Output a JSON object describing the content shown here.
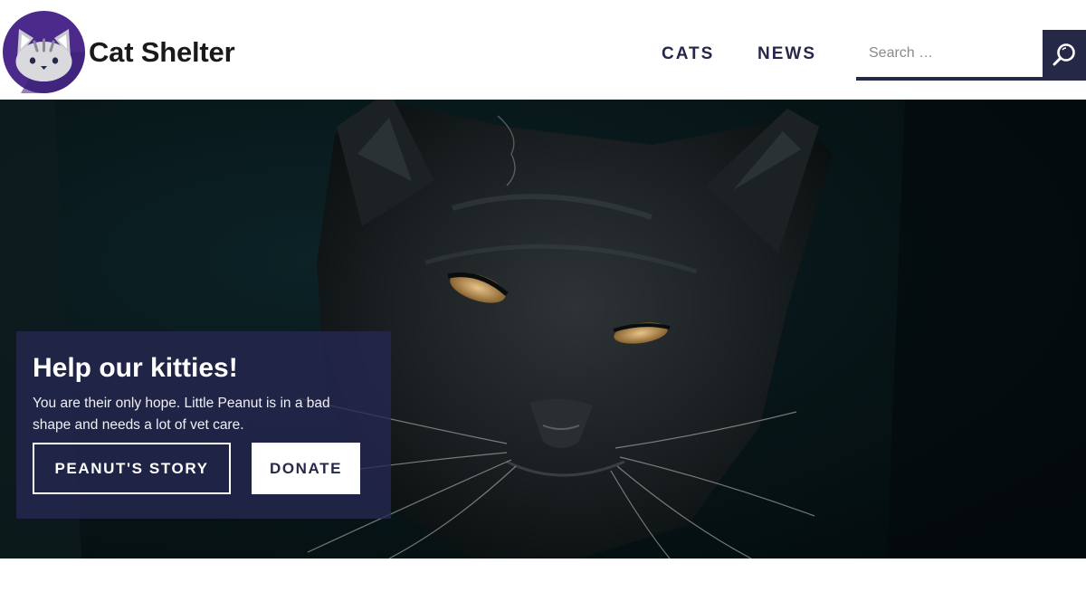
{
  "header": {
    "site_title": "Cat Shelter",
    "logo_icon": "cat-face-icon",
    "nav": [
      {
        "label": "CATS"
      },
      {
        "label": "NEWS"
      }
    ],
    "search": {
      "placeholder": "Search …",
      "value": "",
      "button_icon": "search-icon"
    }
  },
  "hero": {
    "image": "black-cat-photo",
    "title": "Help our kitties!",
    "text": "You are their only hope. Little Peanut is in a bad shape and needs a lot of vet care.",
    "buttons": {
      "story": "PEANUT'S STORY",
      "donate": "DONATE"
    }
  },
  "colors": {
    "brand_navy": "#262848",
    "logo_purple": "#4b2a8c",
    "panel_overlay": "#262852",
    "hero_dark": "#061416"
  }
}
